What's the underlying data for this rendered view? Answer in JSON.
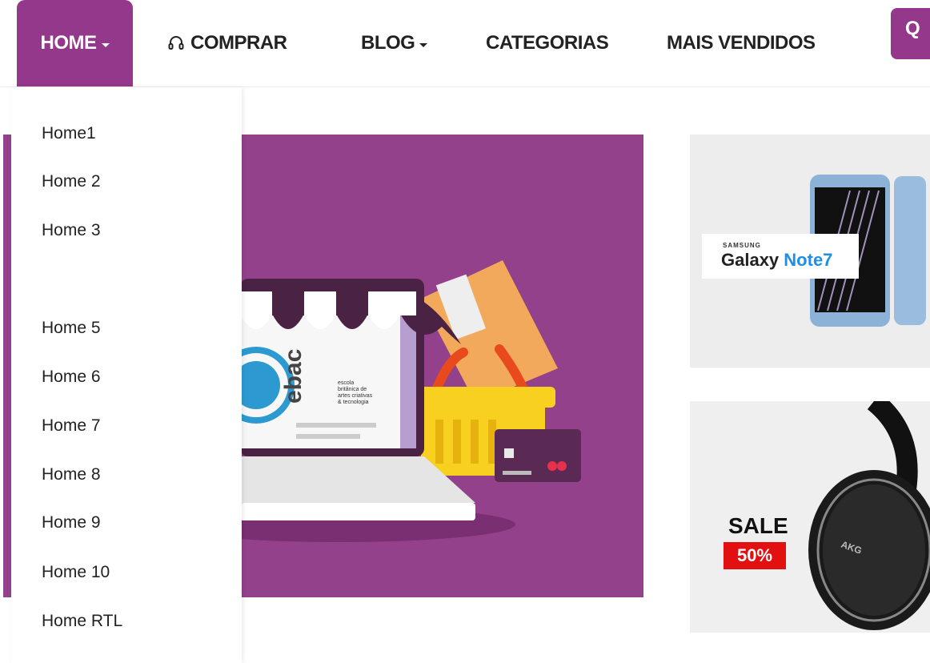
{
  "nav": {
    "items": [
      {
        "label": "HOME",
        "active": true,
        "has_caret": true
      },
      {
        "label": "COMPRAR",
        "icon": "headset-icon"
      },
      {
        "label": "BLOG",
        "has_caret": true
      },
      {
        "label": "CATEGORIAS"
      },
      {
        "label": "MAIS VENDIDOS"
      }
    ],
    "search_label": "Q"
  },
  "dropdown": {
    "items": [
      "Home1",
      "Home 2",
      "Home 3",
      "Home 5",
      "Home 6",
      "Home 7",
      "Home 8",
      "Home 9",
      "Home 10",
      "Home RTL"
    ]
  },
  "banners": {
    "main": {
      "logo_letters": "ebac",
      "logo_lines": [
        "escola",
        "britânica de",
        "artes criativas",
        "& tecnologia"
      ]
    },
    "side1": {
      "brand": "SAMSUNG",
      "text_galaxy": "Galaxy",
      "text_model": "Note7"
    },
    "side2": {
      "sale": "SALE",
      "percent": "50%",
      "brand_on_product": "AKG"
    }
  },
  "colors": {
    "accent": "#93388a",
    "sale_red": "#e21010",
    "galaxy_blue": "#1f8fe6"
  }
}
